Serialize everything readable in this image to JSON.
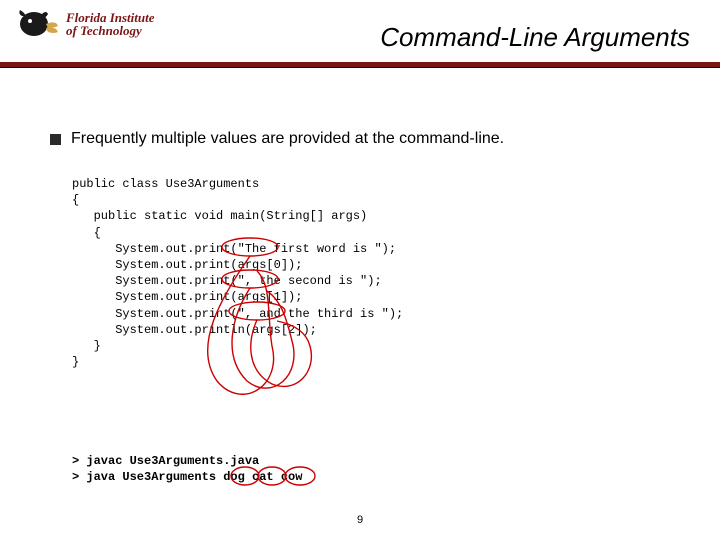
{
  "header": {
    "logo_line1": "Florida Institute",
    "logo_line2": "of Technology",
    "title": "Command-Line Arguments"
  },
  "bullet": {
    "text": "Frequently multiple values are provided at the command-line."
  },
  "code": {
    "l1": "public class Use3Arguments",
    "l2": "{",
    "l3": "   public static void main(String[] args)",
    "l4": "   {",
    "l5": "      System.out.print(\"The first word is \");",
    "l6": "      System.out.print(args[0]);",
    "l7": "      System.out.print(\", the second is \");",
    "l8": "      System.out.print(args[1]);",
    "l9": "      System.out.print(\", and the third is \");",
    "l10": "      System.out.println(args[2]);",
    "l11": "   }",
    "l12": "}"
  },
  "cmd": {
    "l1": "> javac Use3Arguments.java",
    "l2": "> java Use3Arguments dog cat cow"
  },
  "page": "9"
}
